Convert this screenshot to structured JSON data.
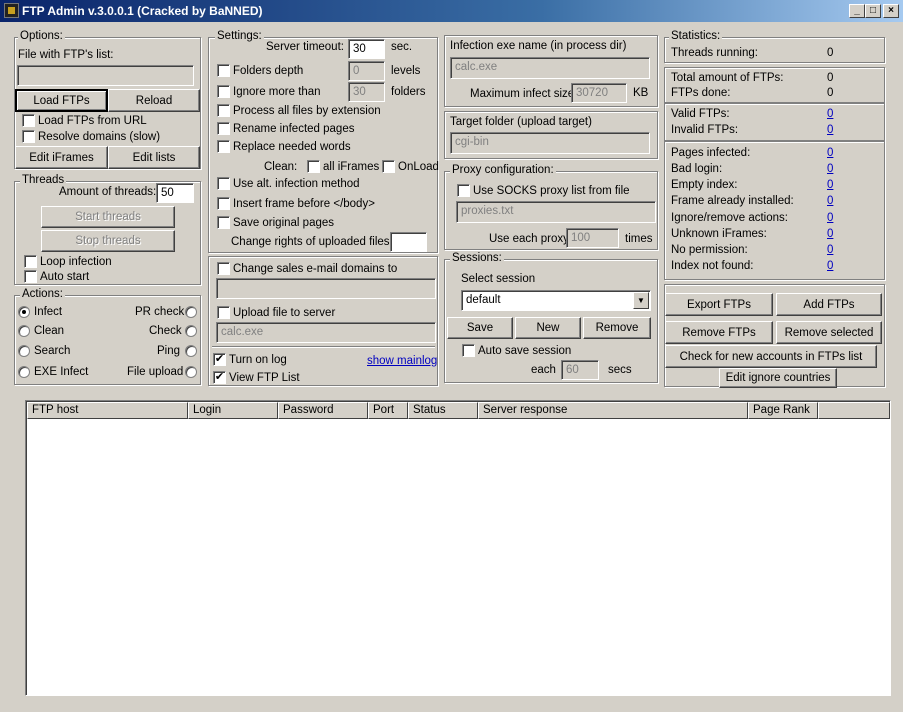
{
  "window": {
    "title": "FTP Admin v.3.0.0.1 (Cracked by BaNNED)",
    "min": "_",
    "max": "□",
    "close": "×"
  },
  "options": {
    "title": "Options:",
    "file_label": "File with FTP's list:",
    "file_value": "",
    "load_ftps": "Load FTPs",
    "reload": "Reload",
    "load_from_url": "Load FTPs from URL",
    "resolve_domains": "Resolve domains (slow)",
    "edit_iframes": "Edit iFrames",
    "edit_lists": "Edit lists"
  },
  "threads": {
    "title": "Threads",
    "amount_label": "Amount of threads:",
    "amount_value": "50",
    "start": "Start threads",
    "stop": "Stop threads",
    "loop": "Loop infection",
    "autostart": "Auto start"
  },
  "actions": {
    "title": "Actions:",
    "infect": "Infect",
    "clean": "Clean",
    "search": "Search",
    "exe_infect": "EXE Infect",
    "pr_check": "PR check",
    "check": "Check",
    "ping": "Ping",
    "file_upload": "File upload"
  },
  "settings": {
    "title": "Settings:",
    "timeout_label": "Server timeout:",
    "timeout_value": "30",
    "timeout_unit": "sec.",
    "folders_depth": "Folders depth",
    "depth_value": "0",
    "depth_unit": "levels",
    "ignore_more": "Ignore more than",
    "ignore_value": "30",
    "ignore_unit": "folders",
    "process_all": "Process all files by extension",
    "rename_infected": "Rename infected pages",
    "replace_words": "Replace needed words",
    "clean_label": "Clean:",
    "all_iframes": "all iFrames",
    "onload": "OnLoad",
    "alt_method": "Use alt. infection method",
    "insert_frame": "Insert frame before </body>",
    "save_original": "Save original pages",
    "change_rights": "Change rights of uploaded files",
    "rights_value": "",
    "change_sales": "Change sales e-mail domains to",
    "sales_value": "",
    "upload_file": "Upload file to server",
    "upload_value": "calc.exe",
    "turn_on_log": "Turn on log",
    "show_mainlog": "show mainlog",
    "view_ftp_list": "View FTP List"
  },
  "infection": {
    "exe_label": "Infection exe name (in process dir)",
    "exe_value": "calc.exe",
    "max_size_label": "Maximum infect size:",
    "max_size_value": "30720",
    "max_size_unit": "KB",
    "target_label": "Target folder (upload target)",
    "target_value": "cgi-bin"
  },
  "proxy": {
    "title": "Proxy configuration:",
    "use_socks": "Use SOCKS proxy list from file",
    "file_value": "proxies.txt",
    "each_label": "Use each proxy",
    "each_value": "100",
    "each_unit": "times"
  },
  "sessions": {
    "title": "Sessions:",
    "select_label": "Select session",
    "selected": "default",
    "save": "Save",
    "new": "New",
    "remove": "Remove",
    "auto_save": "Auto save session",
    "each_label": "each",
    "each_value": "60",
    "each_unit": "secs"
  },
  "statistics": {
    "title": "Statistics:",
    "threads_running": "Threads running:",
    "threads_running_v": "0",
    "total_ftps": "Total amount of FTPs:",
    "total_ftps_v": "0",
    "ftps_done": "FTPs done:",
    "ftps_done_v": "0",
    "valid": "Valid FTPs:",
    "valid_v": "0",
    "invalid": "Invalid FTPs:",
    "invalid_v": "0",
    "pages_infected": "Pages infected:",
    "pages_infected_v": "0",
    "bad_login": "Bad login:",
    "bad_login_v": "0",
    "empty_index": "Empty index:",
    "empty_index_v": "0",
    "frame_installed": "Frame already installed:",
    "frame_installed_v": "0",
    "ignore_remove": "Ignore/remove actions:",
    "ignore_remove_v": "0",
    "unknown_iframes": "Unknown iFrames:",
    "unknown_iframes_v": "0",
    "no_permission": "No permission:",
    "no_permission_v": "0",
    "index_not_found": "Index not found:",
    "index_not_found_v": "0"
  },
  "buttons": {
    "export_ftps": "Export FTPs",
    "add_ftps": "Add FTPs",
    "remove_ftps": "Remove FTPs",
    "remove_selected": "Remove selected",
    "check_new": "Check for new accounts in FTPs list",
    "edit_ignore": "Edit ignore countries"
  },
  "table": {
    "columns": [
      "FTP host",
      "Login",
      "Password",
      "Port",
      "Status",
      "Server response",
      "Page Rank"
    ]
  }
}
